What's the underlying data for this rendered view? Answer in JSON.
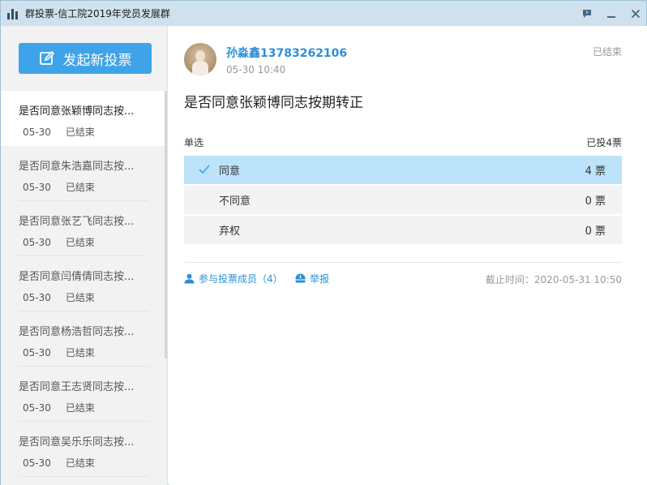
{
  "window": {
    "title": "群投票-信工院2019年党员发展群",
    "controls": [
      "feedback-icon",
      "minimize-icon",
      "close-icon"
    ]
  },
  "sidebar": {
    "new_vote_label": "发起新投票",
    "items": [
      {
        "title": "是否同意张颖博同志按...",
        "date": "05-30",
        "status": "已结束"
      },
      {
        "title": "是否同意朱浩嘉同志按...",
        "date": "05-30",
        "status": "已结束"
      },
      {
        "title": "是否同意张艺飞同志按...",
        "date": "05-30",
        "status": "已结束"
      },
      {
        "title": "是否同意闫倩倩同志按...",
        "date": "05-30",
        "status": "已结束"
      },
      {
        "title": "是否同意杨浩哲同志按...",
        "date": "05-30",
        "status": "已结束"
      },
      {
        "title": "是否同意王志贤同志按...",
        "date": "05-30",
        "status": "已结束"
      },
      {
        "title": "是否同意吴乐乐同志按...",
        "date": "05-30",
        "status": "已结束"
      }
    ]
  },
  "main": {
    "author": "孙淼鑫13783262106",
    "post_time": "05-30 10:40",
    "status": "已结束",
    "vote_title": "是否同意张颖博同志按期转正",
    "vote_type": "单选",
    "vote_total": "已投4票",
    "options": [
      {
        "label": "同意",
        "votes": "4 票",
        "selected": true
      },
      {
        "label": "不同意",
        "votes": "0 票",
        "selected": false
      },
      {
        "label": "弃权",
        "votes": "0 票",
        "selected": false
      }
    ],
    "members_link": "参与投票成员（4）",
    "report_link": "举报",
    "deadline": "截止时间：2020-05-31 10:50"
  },
  "colors": {
    "accent": "#3ea3e8",
    "link": "#2b8fd8",
    "selected_option": "#bde3fb",
    "titlebar": "#cfe1ec"
  }
}
